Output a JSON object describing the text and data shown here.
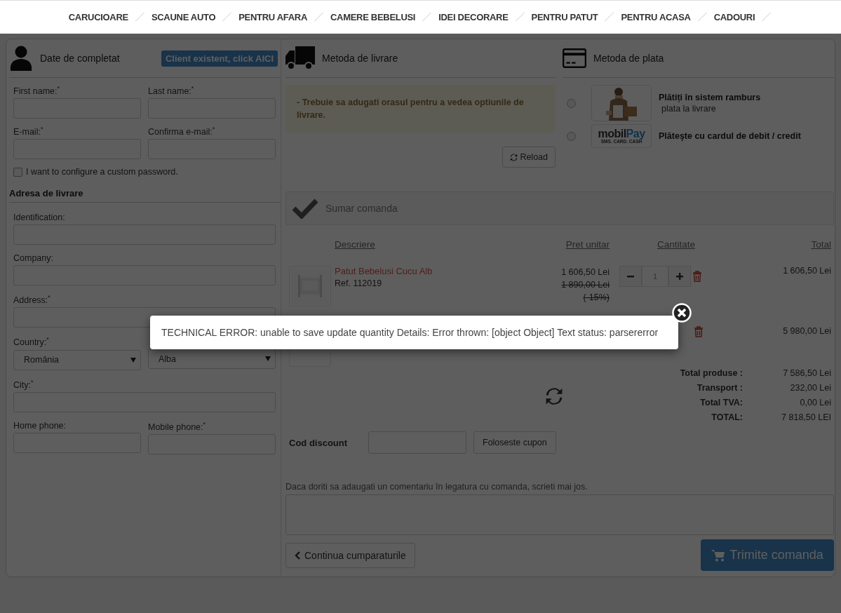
{
  "nav": [
    "CARUCIOARE",
    "SCAUNE AUTO",
    "PENTRU AFARA",
    "CAMERE BEBELUSI",
    "IDEI DECORARE",
    "PENTRU PATUT",
    "PENTRU ACASA",
    "CADOURI"
  ],
  "customer": {
    "title": "Date de completat",
    "login_button": "Client existent, click AICI",
    "fields": [
      {
        "label": "First name:",
        "required_mark": "*"
      },
      {
        "label": "Last name:",
        "required_mark": "*"
      },
      {
        "label": "E-mail:",
        "required_mark": "*"
      },
      {
        "label": "Confirma e-mail:",
        "required_mark": "*"
      }
    ],
    "password_option": {
      "label": "I want to configure a custom password.",
      "checked": false
    },
    "address_title": "Adresa de livrare",
    "address_rows": [
      [
        {
          "label": "Identification:",
          "kind": "input"
        }
      ],
      [
        {
          "label": "Company:",
          "kind": "input"
        }
      ],
      [
        {
          "label": "Address:",
          "required_mark": "*",
          "kind": "input"
        }
      ],
      [
        {
          "label": "Country:",
          "required_mark": "*",
          "kind": "select",
          "value": "România"
        },
        {
          "kind": "select",
          "value": "Alba"
        }
      ],
      [
        {
          "label": "City:",
          "required_mark": "*",
          "kind": "input"
        }
      ],
      [
        {
          "label": "Home phone:",
          "kind": "input"
        },
        {
          "label": "Mobile phone:",
          "required_mark": "*",
          "kind": "input"
        }
      ]
    ]
  },
  "delivery": {
    "title": "Metoda de livrare",
    "warning": "- Trebuie sa adugati orasul pentru a vedea optiunile de livrare.",
    "reload_button": "Reload"
  },
  "payment": {
    "title": "Metoda de plata",
    "options": [
      {
        "kind": "picture",
        "title": "Plătiți în sistem ramburs",
        "subtitle": "plata la livrare",
        "selected": false
      },
      {
        "kind": "logo",
        "logo_parts": [
          "mobil",
          "Pay"
        ],
        "logo_tagline": "SMS. CARD. CASH",
        "title": "Plăteşte cu cardul de debit / credit",
        "selected": false
      }
    ]
  },
  "summary": {
    "title": "Sumar comanda",
    "columns": [
      "Descriere",
      "Pret unitar",
      "Cantitate",
      "Total"
    ],
    "rows": [
      {
        "name": "Patut Bebelusi Cucu Alb",
        "ref": "Ref. 112019",
        "price": "1 606,50 Lei",
        "old_price": "1 890,00 Lei",
        "discount": "(-15%)",
        "quantity": "1",
        "total": "1 606,50 Lei"
      },
      {
        "total": "5 980,00 Lei"
      }
    ],
    "totals": [
      {
        "label": "Total produse :",
        "value": "7 586,50 Lei"
      },
      {
        "label": "Transport :",
        "value": "232,00 Lei"
      },
      {
        "label": "Total TVA:",
        "value": "0,00 Lei"
      },
      {
        "label": "TOTAL:",
        "value": "7 818,50 LEI"
      }
    ],
    "discount_label": "Cod discount",
    "coupon_button": "Foloseste cupon",
    "comment_label": "Daca doriti sa adaugati un comentariu în legatura cu comanda, scrieti mai jos.",
    "back_button": "Continua cumparaturile",
    "submit_button": "Trimite comanda"
  },
  "error_dialog": {
    "message": "TECHNICAL ERROR: unable to save update quantity Details: Error thrown: [object Object] Text status: parsererror"
  }
}
